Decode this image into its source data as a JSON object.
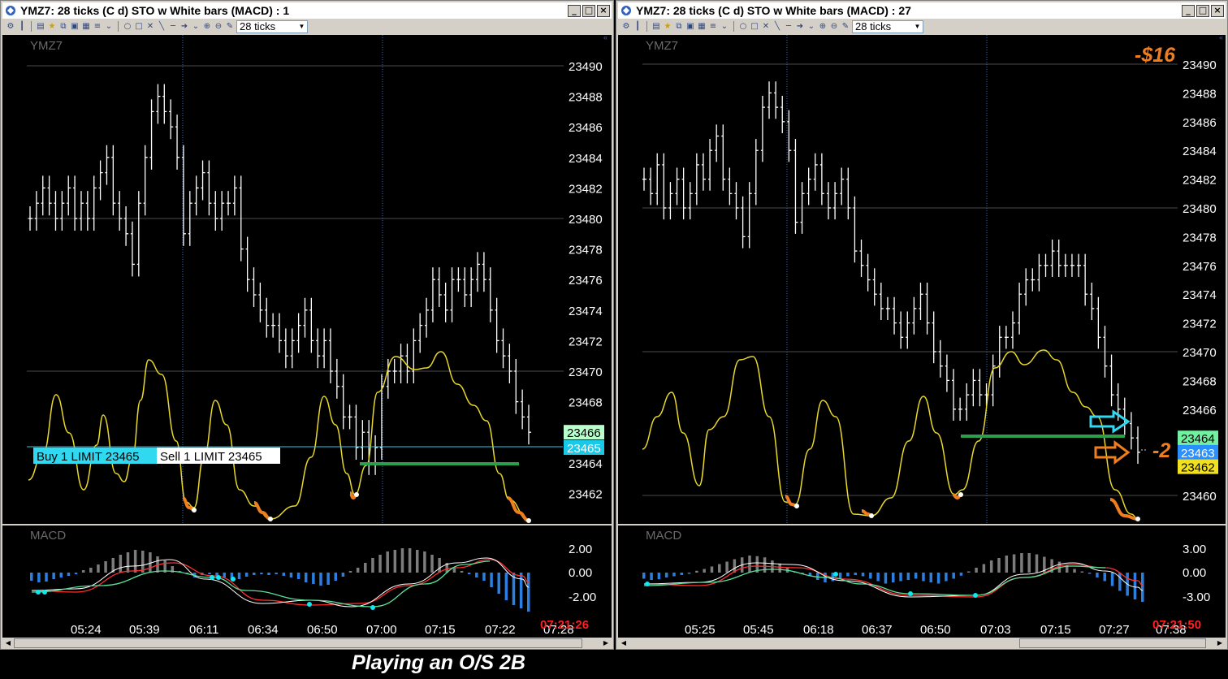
{
  "colors": {
    "price_bar": "#ffffff",
    "stochastic": "#e8d82a",
    "oversold": "#f07e1e",
    "macd_pos": "#7c7c7c",
    "macd_neg": "#2a7fe0",
    "macd_fast": "#ffffff",
    "macd_slow": "#ff3030",
    "signal_green": "#58e09a",
    "cyan_dot": "#10e8f0",
    "level_line": "#2aa04a",
    "time_red": "#ff2020",
    "annot_orange": "#f07e1e",
    "annot_cyan": "#30d8f0"
  },
  "icons": [
    "ymz-app-icon",
    "chart-type-icon",
    "open-icon",
    "star-icon",
    "save-icon",
    "copy-icon",
    "grid-icon",
    "bars-icon",
    "ellipse-icon",
    "rectangle-icon",
    "cross-icon",
    "line-icon",
    "arrow-icon",
    "zoom-in-icon",
    "zoom-out-icon",
    "pen-icon"
  ],
  "caption": "Playing an O/S 2B",
  "left": {
    "title": "YMZ7: 28 ticks (C d) STO w White bars  (MACD) : 1",
    "interval": "28 ticks",
    "symbol_label": "YMZ7",
    "macd_label": "MACD",
    "y_ticks": [
      "23490",
      "23488",
      "23486",
      "23484",
      "23482",
      "23480",
      "23478",
      "23476",
      "23474",
      "23472",
      "23470",
      "23468",
      "23466",
      "23465",
      "23464",
      "23462"
    ],
    "price_badges": {
      "upper": "23466",
      "lower": "23465"
    },
    "buy_order": "Buy 1 LIMIT 23465",
    "sell_order": "Sell 1 LIMIT 23465",
    "macd_ticks": [
      "2.00",
      "0.00",
      "-2.00"
    ],
    "time_labels": [
      "05:24",
      "05:39",
      "06:11",
      "06:34",
      "06:50",
      "07:00",
      "07:15",
      "07:22",
      "07:28"
    ],
    "clock": "07:21:26"
  },
  "right": {
    "title": "YMZ7: 28 ticks (C d) STO w White bars  (MACD) : 27",
    "interval": "28 ticks",
    "symbol_label": "YMZ7",
    "macd_label": "MACD",
    "y_ticks": [
      "23490",
      "23488",
      "23486",
      "23484",
      "23482",
      "23480",
      "23478",
      "23476",
      "23474",
      "23472",
      "23470",
      "23468",
      "23466",
      "23464",
      "23463",
      "23462",
      "23460"
    ],
    "price_badges": {
      "upper": "23464",
      "middle": "23463",
      "lower": "23462"
    },
    "pnl": "-$16",
    "position": "-2",
    "macd_ticks": [
      "3.00",
      "0.00",
      "-3.00"
    ],
    "time_labels": [
      "05:25",
      "05:45",
      "06:18",
      "06:37",
      "06:50",
      "07:03",
      "07:15",
      "07:27",
      "07:38"
    ],
    "clock": "07:21:50"
  },
  "series": {
    "left_bars": [
      23480,
      23481,
      23482,
      23481,
      23480,
      23481,
      23482,
      23480,
      23481,
      23480,
      23482,
      23483,
      23484,
      23481,
      23480,
      23479,
      23477,
      23481,
      23484,
      23487,
      23488,
      23487,
      23486,
      23484,
      23479,
      23481,
      23482,
      23483,
      23481,
      23480,
      23481,
      23481,
      23482,
      23478,
      23476,
      23475,
      23474,
      23473,
      23473,
      23472,
      23471,
      23472,
      23473,
      23474,
      23472,
      23471,
      23472,
      23470,
      23469,
      23467,
      23467,
      23465,
      23466,
      23464,
      23465,
      23469,
      23470,
      23470,
      23471,
      23470,
      23472,
      23473,
      23474,
      23476,
      23475,
      23474,
      23476,
      23476,
      23475,
      23476,
      23477,
      23476,
      23474,
      23472,
      23471,
      23470,
      23468,
      23467,
      23466
    ],
    "right_bars": [
      23482,
      23481,
      23483,
      23480,
      23481,
      23482,
      23480,
      23481,
      23483,
      23482,
      23484,
      23485,
      23482,
      23481,
      23480,
      23478,
      23481,
      23484,
      23487,
      23488,
      23487,
      23486,
      23484,
      23479,
      23481,
      23482,
      23483,
      23481,
      23480,
      23481,
      23482,
      23480,
      23477,
      23476,
      23475,
      23474,
      23473,
      23473,
      23472,
      23471,
      23472,
      23473,
      23474,
      23472,
      23470,
      23469,
      23468,
      23466,
      23466,
      23467,
      23468,
      23467,
      23467,
      23469,
      23471,
      23471,
      23472,
      23474,
      23475,
      23475,
      23476,
      23476,
      23477,
      23476,
      23476,
      23476,
      23476,
      23474,
      23473,
      23471,
      23469,
      23467,
      23466,
      23465,
      23464,
      23463
    ]
  }
}
